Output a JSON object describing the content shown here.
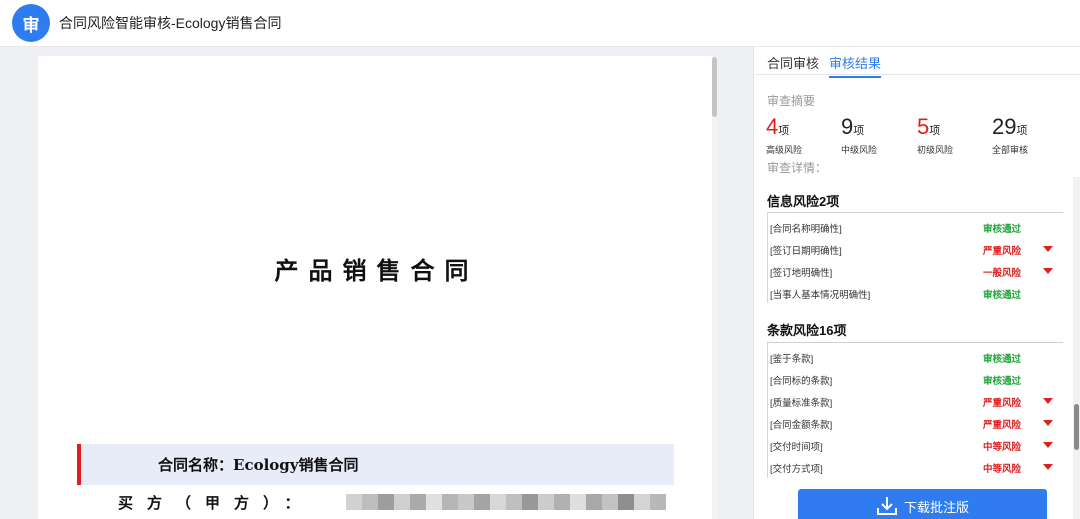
{
  "header": {
    "badge": "审",
    "title": "合同风险智能审核-Ecology销售合同"
  },
  "document": {
    "title": "产品销售合同",
    "contract_name_label": "合同名称：",
    "contract_name_value": "Ecology销售合同",
    "buyer_label": "买方（甲方）："
  },
  "panel": {
    "tabs": [
      {
        "label": "合同审核",
        "active": false
      },
      {
        "label": "审核结果",
        "active": true
      }
    ],
    "summary_label": "审查摘要",
    "stats": [
      {
        "value": "4",
        "unit": "项",
        "label": "高级风险",
        "color": "#e02020"
      },
      {
        "value": "9",
        "unit": "项",
        "label": "中级风险",
        "color": "#222222"
      },
      {
        "value": "5",
        "unit": "项",
        "label": "初级风险",
        "color": "#e02020"
      },
      {
        "value": "29",
        "unit": "项",
        "label": "全部审核",
        "color": "#222222"
      }
    ],
    "details_label": "审查详情：",
    "groups": [
      {
        "title": "信息风险2项",
        "rows": [
          {
            "name": "[合同名称明确性]",
            "status": "审核通过",
            "status_color": "#22a33a",
            "has_caret": false
          },
          {
            "name": "[签订日期明确性]",
            "status": "严重风险",
            "status_color": "#e02020",
            "has_caret": true
          },
          {
            "name": "[签订地明确性]",
            "status": "一般风险",
            "status_color": "#e02020",
            "has_caret": true
          },
          {
            "name": "[当事人基本情况明确性]",
            "status": "审核通过",
            "status_color": "#22a33a",
            "has_caret": false
          }
        ]
      },
      {
        "title": "条款风险16项",
        "rows": [
          {
            "name": "[鉴于条款]",
            "status": "审核通过",
            "status_color": "#22a33a",
            "has_caret": false
          },
          {
            "name": "[合同标的条款]",
            "status": "审核通过",
            "status_color": "#22a33a",
            "has_caret": false
          },
          {
            "name": "[质量标准条款]",
            "status": "严重风险",
            "status_color": "#e02020",
            "has_caret": true
          },
          {
            "name": "[合同金额条款]",
            "status": "严重风险",
            "status_color": "#e02020",
            "has_caret": true
          },
          {
            "name": "[交付时间项]",
            "status": "中等风险",
            "status_color": "#e02020",
            "has_caret": true
          },
          {
            "name": "[交付方式项]",
            "status": "中等风险",
            "status_color": "#e02020",
            "has_caret": true
          }
        ]
      }
    ],
    "download_label": "下载批注版",
    "accent_color": "#2f7cf0"
  }
}
